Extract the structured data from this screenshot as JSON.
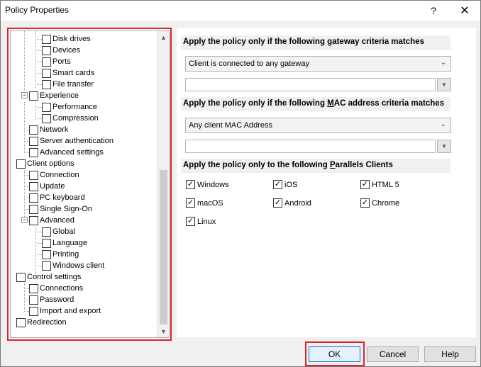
{
  "window": {
    "title": "Policy Properties",
    "help_glyph": "?",
    "close_glyph": "✕"
  },
  "tree": {
    "items": [
      {
        "label": "Disk drives",
        "level": 2
      },
      {
        "label": "Devices",
        "level": 2
      },
      {
        "label": "Ports",
        "level": 2
      },
      {
        "label": "Smart cards",
        "level": 2
      },
      {
        "label": "File transfer",
        "level": 2
      },
      {
        "label": "Experience",
        "level": 1,
        "expander": "−"
      },
      {
        "label": "Performance",
        "level": 2
      },
      {
        "label": "Compression",
        "level": 2
      },
      {
        "label": "Network",
        "level": 1
      },
      {
        "label": "Server authentication",
        "level": 1
      },
      {
        "label": "Advanced settings",
        "level": 1
      },
      {
        "label": "Client options",
        "level": 0
      },
      {
        "label": "Connection",
        "level": 1
      },
      {
        "label": "Update",
        "level": 1
      },
      {
        "label": "PC keyboard",
        "level": 1
      },
      {
        "label": "Single Sign-On",
        "level": 1
      },
      {
        "label": "Advanced",
        "level": 1,
        "expander": "−"
      },
      {
        "label": "Global",
        "level": 2
      },
      {
        "label": "Language",
        "level": 2
      },
      {
        "label": "Printing",
        "level": 2
      },
      {
        "label": "Windows client",
        "level": 2
      },
      {
        "label": "Control settings",
        "level": 0
      },
      {
        "label": "Connections",
        "level": 1
      },
      {
        "label": "Password",
        "level": 1
      },
      {
        "label": "Import and export",
        "level": 1
      },
      {
        "label": "Redirection",
        "level": 0
      }
    ],
    "scroll_up_glyph": "▲",
    "scroll_down_glyph": "▼"
  },
  "gateway": {
    "header_pre": "Apply the policy only if the following ",
    "header_key": "g",
    "header_post": "ateway criteria matches",
    "combo_value": "Client is connected to any gateway",
    "text_value": ""
  },
  "mac": {
    "header_pre": "Apply the policy only if the following ",
    "header_key": "M",
    "header_post": "AC address criteria matches",
    "combo_value": "Any client MAC Address",
    "text_value": ""
  },
  "clients": {
    "header_pre": "Apply the policy only to the following ",
    "header_key": "P",
    "header_post": "arallels Clients",
    "options": [
      {
        "label": "Windows",
        "checked": true
      },
      {
        "label": "iOS",
        "checked": true
      },
      {
        "label": "HTML 5",
        "checked": true
      },
      {
        "label": "macOS",
        "checked": true
      },
      {
        "label": "Android",
        "checked": true
      },
      {
        "label": "Chrome",
        "checked": true
      },
      {
        "label": "Linux",
        "checked": true
      }
    ],
    "check_glyph": "✓"
  },
  "buttons": {
    "ok": "OK",
    "cancel": "Cancel",
    "help": "Help"
  },
  "icons": {
    "combo_arrow": "chevron-down-icon",
    "small_drop": "triangle-down-icon"
  },
  "colors": {
    "highlight": "#d9232d",
    "focus": "#0078d7"
  }
}
